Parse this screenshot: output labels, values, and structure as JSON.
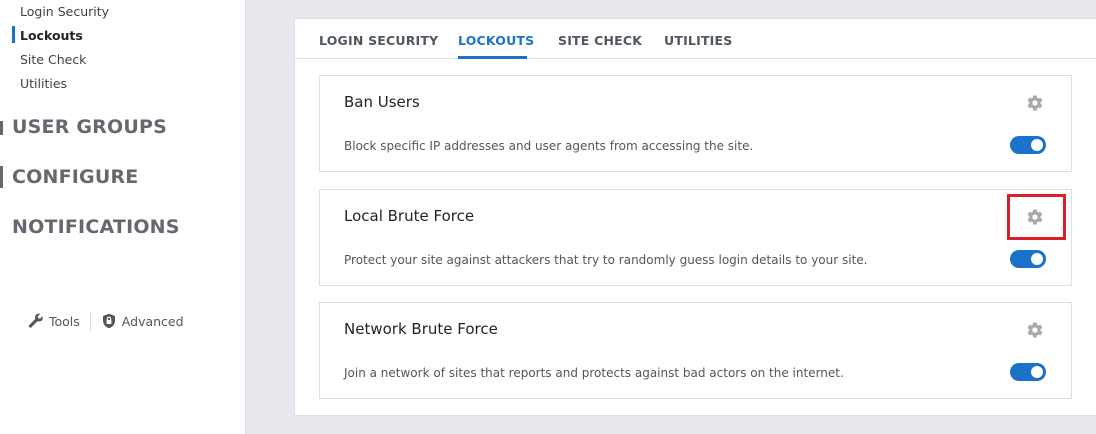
{
  "sidebar": {
    "sub_items": [
      {
        "label": "Login Security",
        "active": false
      },
      {
        "label": "Lockouts",
        "active": true
      },
      {
        "label": "Site Check",
        "active": false
      },
      {
        "label": "Utilities",
        "active": false
      }
    ],
    "groups": [
      {
        "label": "USER GROUPS"
      },
      {
        "label": "CONFIGURE"
      },
      {
        "label": "NOTIFICATIONS"
      }
    ],
    "footer": {
      "tools_label": "Tools",
      "advanced_label": "Advanced"
    }
  },
  "tabs": [
    {
      "label": "LOGIN SECURITY",
      "active": false
    },
    {
      "label": "LOCKOUTS",
      "active": true
    },
    {
      "label": "SITE CHECK",
      "active": false
    },
    {
      "label": "UTILITIES",
      "active": false
    }
  ],
  "modules": [
    {
      "title": "Ban Users",
      "description": "Block specific IP addresses and user agents from accessing the site.",
      "enabled": true
    },
    {
      "title": "Local Brute Force",
      "description": "Protect your site against attackers that try to randomly guess login details to your site.",
      "enabled": true,
      "highlighted": true
    },
    {
      "title": "Network Brute Force",
      "description": "Join a network of sites that reports and protects against bad actors on the internet.",
      "enabled": true
    }
  ],
  "colors": {
    "accent": "#1a73c9",
    "highlight": "#d9202a",
    "gear": "#a7aaad"
  }
}
